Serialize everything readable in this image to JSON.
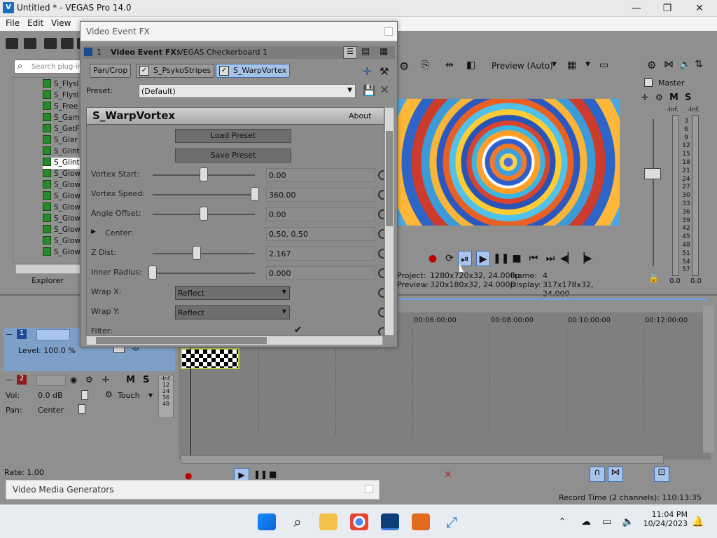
{
  "window": {
    "title": "Untitled * - VEGAS Pro 14.0",
    "logo": "V",
    "controls": {
      "minimize": "—",
      "maximize": "❐",
      "close": "✕"
    }
  },
  "menu": [
    "File",
    "Edit",
    "View"
  ],
  "explorer": {
    "search_placeholder": "Search plug-in",
    "items": [
      "S_Flysl",
      "S_Flysl",
      "S_Free",
      "S_Gam",
      "S_GetF",
      "S_Glar",
      "S_Glint",
      "S_Glint",
      "S_Glow",
      "S_Glow",
      "S_Glow",
      "S_Glow",
      "S_Glow",
      "S_Glow",
      "S_Glow",
      "S_Glow"
    ],
    "selected_index": 7,
    "tab": "Explorer"
  },
  "dialog": {
    "title": "Video Event FX",
    "header_number": "1",
    "header_label": "Video Event FX:",
    "header_value": "VEGAS Checkerboard 1",
    "chain": [
      "Pan/Crop",
      "S_PsykoStripes",
      "S_WarpVortex"
    ],
    "preset_label": "Preset:",
    "preset_value": "(Default)",
    "plugin_name": "S_WarpVortex",
    "about": "About",
    "load_preset": "Load Preset",
    "save_preset": "Save Preset",
    "params": [
      {
        "label": "Vortex Start:",
        "value": "0.00",
        "slider": 0.5
      },
      {
        "label": "Vortex Speed:",
        "value": "360.00",
        "slider": 1.0
      },
      {
        "label": "Angle Offset:",
        "value": "0.00",
        "slider": 0.5
      },
      {
        "label": "Center:",
        "value": "0.50, 0.50"
      },
      {
        "label": "Z Dist:",
        "value": "2.167",
        "slider": 0.43
      },
      {
        "label": "Inner Radius:",
        "value": "0.000",
        "slider": 0.0
      }
    ],
    "wrap_x_label": "Wrap X:",
    "wrap_x_value": "Reflect",
    "wrap_y_label": "Wrap Y:",
    "wrap_y_value": "Reflect",
    "filter_label": "Filter:"
  },
  "preview": {
    "mode": "Preview (Auto)",
    "project_label": "Project:",
    "project_value": "1280x720x32, 24.000p",
    "preview_label": "Preview:",
    "preview_value": "320x180x32, 24.000p",
    "frame_label": "Frame:",
    "frame_value": "4",
    "display_label": "Display:",
    "display_value": "317x178x32, 24.000"
  },
  "master": {
    "label": "Master",
    "inf_left": "-Inf.",
    "inf_right": "-Inf.",
    "scale": [
      "3",
      "6",
      "9",
      "12",
      "15",
      "18",
      "21",
      "24",
      "27",
      "30",
      "33",
      "36",
      "39",
      "42",
      "45",
      "48",
      "51",
      "54",
      "57"
    ],
    "bottom_left": "0.0",
    "bottom_right": "0.0"
  },
  "timeline": {
    "ticks": [
      "00:06:00:00",
      "00:08:00:00",
      "00:10:00:00",
      "00:12:00:00"
    ]
  },
  "tracks": [
    {
      "number": "1",
      "level": "Level: 100.0 %"
    },
    {
      "number": "2",
      "vol_label": "Vol:",
      "vol_value": "0.0 dB",
      "pan_label": "Pan:",
      "pan_value": "Center",
      "automation": "Touch",
      "meter": [
        "-Inf.",
        "12",
        "24",
        "36",
        "48"
      ]
    }
  ],
  "status": {
    "rate": "Rate: 1.00",
    "media_generators": "Video Media Generators",
    "record_time": "Record Time (2 channels): 110:13:35"
  },
  "taskbar": {
    "time": "11:04 PM",
    "date": "10/24/2023"
  }
}
